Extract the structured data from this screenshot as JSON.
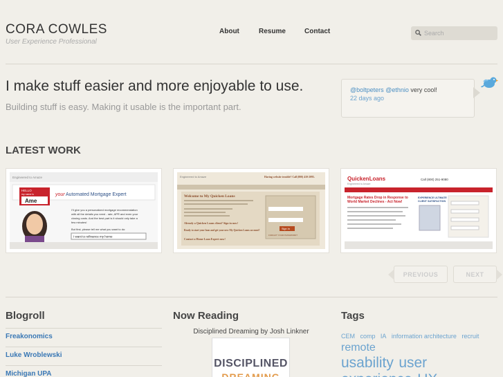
{
  "brand": {
    "name": "CORA COWLES",
    "tagline": "User Experience Professional"
  },
  "nav": {
    "about": "About",
    "resume": "Resume",
    "contact": "Contact"
  },
  "search": {
    "placeholder": "Search"
  },
  "hero": {
    "headline": "I make stuff easier and more enjoyable to use.",
    "subheadline": "Building stuff is easy. Making it usable is the important part."
  },
  "tweet": {
    "mention_1": "@boltpeters",
    "mention_2": "@ethnio",
    "text": " very cool!",
    "time": "22 days ago"
  },
  "latest_work": {
    "heading": "LATEST WORK",
    "thumb_1": {
      "brand": "Engineered to Amaze",
      "title_1": "your",
      "title_2": "Automated Mortgage Expert",
      "badge_1": "HELLO",
      "badge_2": "my name is",
      "badge_name": "Ame",
      "body_1": "I'll give you a personalized mortgage recommendation",
      "body_2": "with all the details you need - rate, APR and even your",
      "body_3": "closing costs. And the best part is it should only take a",
      "body_4": "few minutes!",
      "prompt": "But first, please tell me what you want to do:",
      "select": "I want to refinance my home"
    },
    "thumb_2": {
      "brand": "Engineered to Amaze",
      "heading": "Welcome to My Quicken Loans",
      "help": "Having website trouble? Call (800) 410-2095.",
      "cta_1": "Already a Quicken Loans client? Sign in now!",
      "cta_2": "Ready to start your loan and get your new My Quicken Loans account?",
      "cta_3": "Contact a Home Loan Expert now!",
      "signin": "Sign In",
      "forgot": "FORGOT YOUR PASSWORD?"
    },
    "thumb_3": {
      "logo": "QuickenLoans",
      "logo_sub": "Engineered to Amaze",
      "call": "Call (800) 251-9080",
      "headline_1": "Mortgage Rates Drop in Response to",
      "headline_2": "World Market Declines - Act Now!",
      "award_1": "EXPERIENCE ULTIMATE",
      "award_2": "CLIENT SATISFACTION"
    },
    "prev": "PREVIOUS",
    "next": "NEXT"
  },
  "blogroll": {
    "heading": "Blogroll",
    "items": [
      "Freakonomics",
      "Luke Wroblewski",
      "Michigan UPA"
    ]
  },
  "reading": {
    "heading": "Now Reading",
    "caption": "Disciplined Dreaming by Josh Linkner",
    "cover_1": "DISCIPLINED",
    "cover_2": "DREAMING"
  },
  "tags": {
    "heading": "Tags",
    "items": [
      "CEM",
      "comp",
      "IA",
      "information architecture",
      "recruit",
      "remote",
      "usability",
      "user",
      "experience",
      "UX"
    ]
  },
  "colors": {
    "accent": "#3a78b5",
    "tag": "#6ba3cf",
    "background": "#f1efe9"
  }
}
